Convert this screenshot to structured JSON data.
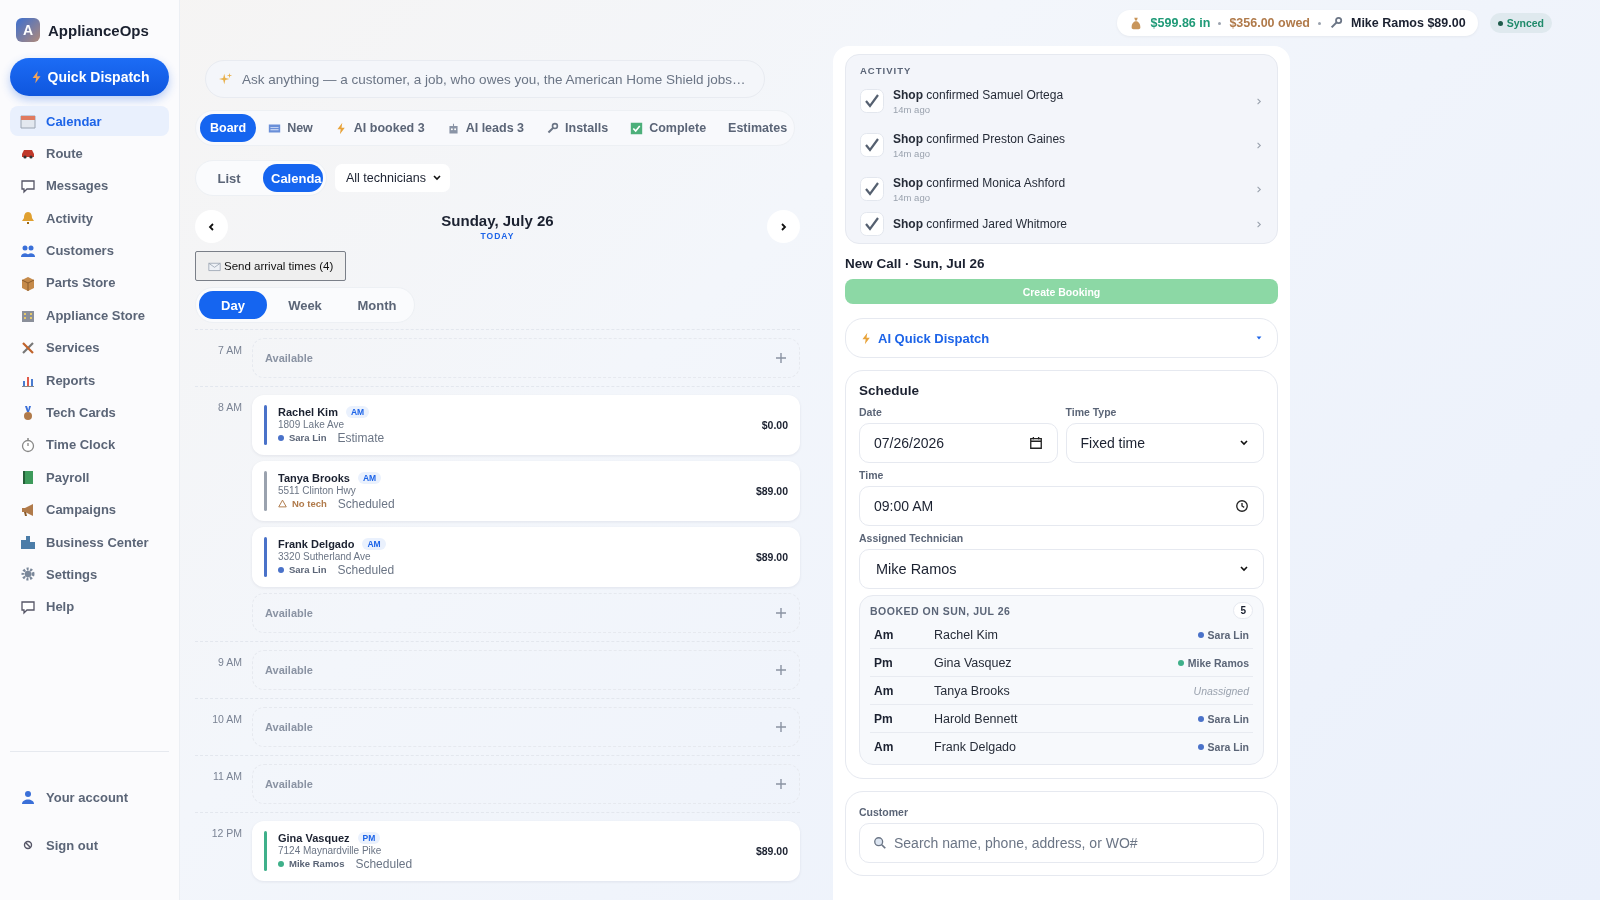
{
  "brand": {
    "initial": "A",
    "name": "ApplianceOps"
  },
  "quick_dispatch": {
    "label": "Quick Dispatch"
  },
  "sidebar": {
    "items": [
      {
        "label": "Calendar",
        "selected": true
      },
      {
        "label": "Route",
        "selected": false
      },
      {
        "label": "Messages",
        "selected": false
      },
      {
        "label": "Activity",
        "selected": false
      },
      {
        "label": "Customers",
        "selected": false
      },
      {
        "label": "Parts Store",
        "selected": false
      },
      {
        "label": "Appliance Store",
        "selected": false
      },
      {
        "label": "Services",
        "selected": false
      },
      {
        "label": "Reports",
        "selected": false
      },
      {
        "label": "Tech Cards",
        "selected": false
      },
      {
        "label": "Time Clock",
        "selected": false
      },
      {
        "label": "Payroll",
        "selected": false
      },
      {
        "label": "Campaigns",
        "selected": false
      },
      {
        "label": "Business Center",
        "selected": false
      },
      {
        "label": "Settings",
        "selected": false
      },
      {
        "label": "Help",
        "selected": false
      }
    ],
    "footer": [
      {
        "label": "Your account"
      },
      {
        "label": "Sign out"
      }
    ]
  },
  "search": {
    "placeholder": "Ask anything — a customer, a job, who owes you, the American Home Shield jobs…"
  },
  "filters": [
    {
      "label": "Board",
      "selected": true
    },
    {
      "label": "New",
      "selected": false
    },
    {
      "label": "AI booked 3",
      "selected": false
    },
    {
      "label": "AI leads 3",
      "selected": false
    },
    {
      "label": "Installs",
      "selected": false
    },
    {
      "label": "Complete",
      "selected": false
    },
    {
      "label": "Estimates",
      "selected": false
    }
  ],
  "view_toggle": [
    {
      "label": "List",
      "selected": false
    },
    {
      "label": "Calenda",
      "selected": true
    }
  ],
  "technician_filter": "All technicians",
  "date": {
    "title": "Sunday, July 26",
    "subtitle": "TODAY"
  },
  "send_arrival": "Send arrival times (4)",
  "range": [
    {
      "label": "Day",
      "selected": true
    },
    {
      "label": "Week",
      "selected": false
    },
    {
      "label": "Month",
      "selected": false
    }
  ],
  "hours": [
    {
      "label": "7 AM",
      "items": [
        {
          "kind": "available",
          "label": "Available"
        }
      ]
    },
    {
      "label": "8 AM",
      "items": [
        {
          "kind": "job",
          "name": "Rachel Kim",
          "slot": "AM",
          "address": "1809 Lake Ave",
          "assigned": true,
          "tech": "Sara Lin",
          "color": "#4a72c9",
          "status": "Estimate",
          "price": "$0.00"
        },
        {
          "kind": "job",
          "name": "Tanya Brooks",
          "slot": "AM",
          "address": "5511 Clinton Hwy",
          "assigned": false,
          "tech": "No tech",
          "color": "#9aa2ae",
          "status": "Scheduled",
          "price": "$89.00"
        },
        {
          "kind": "job",
          "name": "Frank Delgado",
          "slot": "AM",
          "address": "3320 Sutherland Ave",
          "assigned": true,
          "tech": "Sara Lin",
          "color": "#4a72c9",
          "status": "Scheduled",
          "price": "$89.00"
        },
        {
          "kind": "available",
          "label": "Available"
        }
      ]
    },
    {
      "label": "9 AM",
      "items": [
        {
          "kind": "available",
          "label": "Available"
        }
      ]
    },
    {
      "label": "10 AM",
      "items": [
        {
          "kind": "available",
          "label": "Available"
        }
      ]
    },
    {
      "label": "11 AM",
      "items": [
        {
          "kind": "available",
          "label": "Available"
        }
      ]
    },
    {
      "label": "12 PM",
      "items": [
        {
          "kind": "job",
          "name": "Gina Vasquez",
          "slot": "PM",
          "address": "7124 Maynardville Pike",
          "assigned": true,
          "tech": "Mike Ramos",
          "color": "#3fb08a",
          "status": "Scheduled",
          "price": "$89.00"
        }
      ]
    }
  ],
  "stats": {
    "income": "$599.86 in",
    "owed": "$356.00 owed",
    "tech": "Mike Ramos $89.00"
  },
  "sync": {
    "label": "Synced"
  },
  "activity": {
    "title": "ACTIVITY",
    "items": [
      {
        "text": "**Shop** confirmed Samuel Ortega",
        "time": "14m ago"
      },
      {
        "text": "**Shop** confirmed Preston Gaines",
        "time": "14m ago"
      },
      {
        "text": "**Shop** confirmed Monica Ashford",
        "time": "14m ago"
      },
      {
        "text": "**Shop** confirmed Jared Whitmore"
      }
    ]
  },
  "new_call": {
    "title": "New Call · Sun, Jul 26",
    "button": "Create Booking"
  },
  "ai_dispatch": {
    "label": "AI Quick Dispatch"
  },
  "schedule": {
    "title": "Schedule",
    "date_label": "Date",
    "date": "07/26/2026",
    "time_type_label": "Time Type",
    "time_type": "Fixed time",
    "time_label": "Time",
    "time": "09:00 AM",
    "tech_label": "Assigned Technician",
    "tech": "Mike Ramos",
    "booked": {
      "title": "BOOKED ON SUN, JUL 26",
      "count": "5",
      "rows": [
        {
          "period": "Am",
          "name": "Rachel Kim",
          "assigned": true,
          "tech": "Sara Lin",
          "color": "#4a72c9"
        },
        {
          "period": "Pm",
          "name": "Gina Vasquez",
          "assigned": true,
          "tech": "Mike Ramos",
          "color": "#3fb08a"
        },
        {
          "period": "Am",
          "name": "Tanya Brooks",
          "assigned": false,
          "tech": "Unassigned"
        },
        {
          "period": "Pm",
          "name": "Harold Bennett",
          "assigned": true,
          "tech": "Sara Lin",
          "color": "#4a72c9"
        },
        {
          "period": "Am",
          "name": "Frank Delgado",
          "assigned": true,
          "tech": "Sara Lin",
          "color": "#4a72c9"
        }
      ]
    }
  },
  "customer": {
    "label": "Customer",
    "placeholder": "Search name, phone, address, or WO#"
  }
}
